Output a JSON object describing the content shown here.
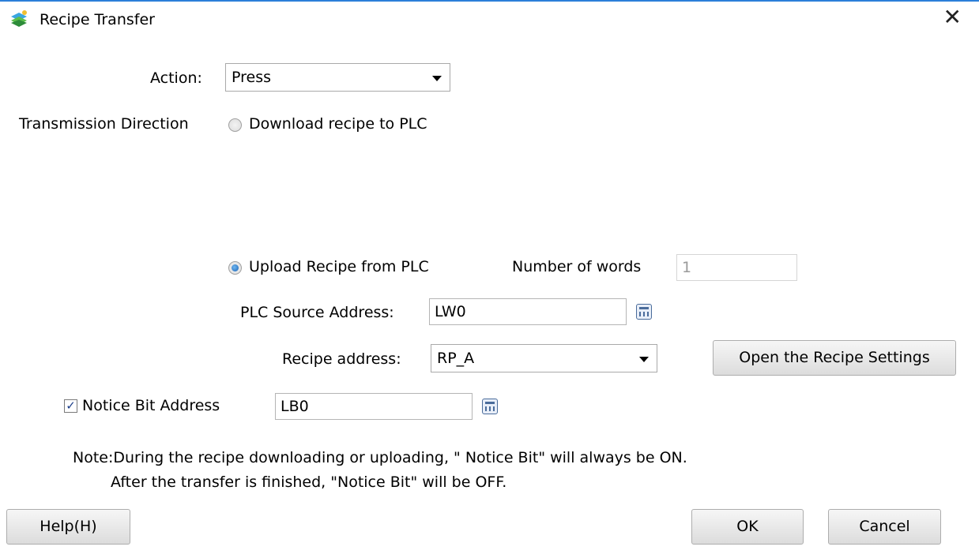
{
  "window": {
    "title": "Recipe Transfer",
    "close_glyph": "✕",
    "icon": "app-icon"
  },
  "action": {
    "label": "Action:",
    "value": "Press"
  },
  "direction": {
    "label": "Transmission Direction",
    "download_label": "Download recipe to PLC",
    "upload_label": "Upload Recipe from PLC",
    "selected": "upload"
  },
  "number_of_words": {
    "label": "Number of words",
    "value": "1"
  },
  "plc_source": {
    "label": "PLC Source Address:",
    "value": "LW0"
  },
  "recipe_address": {
    "label": "Recipe address:",
    "value": "RP_A",
    "settings_button": "Open the Recipe Settings"
  },
  "notice_bit": {
    "label": "Notice Bit Address",
    "value": "LB0",
    "checked": true
  },
  "note": {
    "line1": "Note:During the recipe downloading or uploading, \" Notice Bit\" will always be ON.",
    "line2": "After the transfer is finished, \"Notice Bit\" will be OFF."
  },
  "buttons": {
    "help": "Help(H)",
    "ok": "OK",
    "cancel": "Cancel"
  }
}
